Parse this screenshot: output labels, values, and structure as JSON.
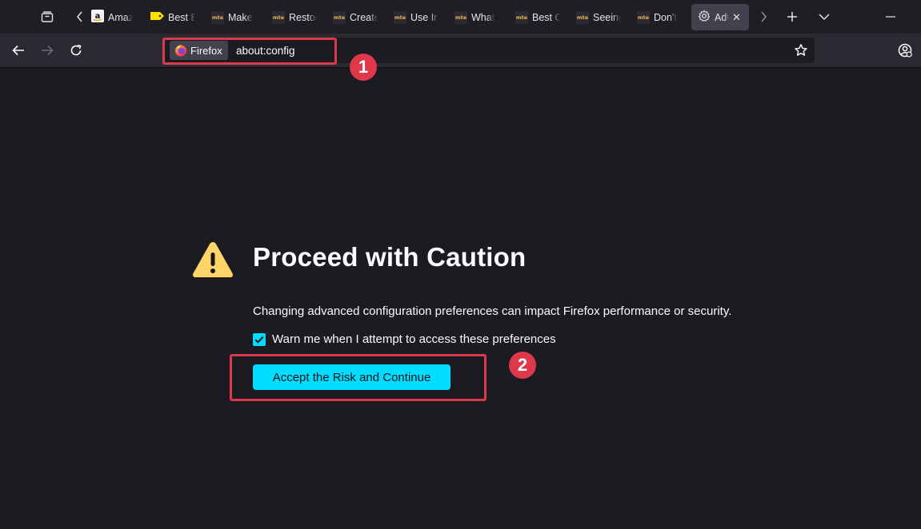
{
  "tabs": [
    {
      "title": "Amazon",
      "favicon": "amazon-icon"
    },
    {
      "title": "Best Buy",
      "favicon": "bestbuy-tag-icon"
    },
    {
      "title": "Make",
      "favicon": "mte-icon"
    },
    {
      "title": "Restore",
      "favicon": "mte-icon"
    },
    {
      "title": "Create",
      "favicon": "mte-icon"
    },
    {
      "title": "Use In",
      "favicon": "mte-icon"
    },
    {
      "title": "What",
      "favicon": "mte-icon"
    },
    {
      "title": "Best C",
      "favicon": "mte-icon"
    },
    {
      "title": "Seeing",
      "favicon": "mte-icon"
    },
    {
      "title": "Don't",
      "favicon": "mte-icon"
    },
    {
      "title": "Advanced Preferences",
      "favicon": "gear-icon",
      "active": true
    }
  ],
  "favicon_text": "mte",
  "urlbar": {
    "identity_label": "Firefox",
    "url": "about:config"
  },
  "page": {
    "heading": "Proceed with Caution",
    "description": "Changing advanced configuration preferences can impact Firefox performance or security.",
    "checkbox_label": "Warn me when I attempt to access these preferences",
    "checkbox_checked": true,
    "accept_button": "Accept the Risk and Continue"
  },
  "annotations": [
    {
      "number": "1"
    },
    {
      "number": "2"
    }
  ],
  "colors": {
    "accent": "#00ddff",
    "annotation": "#e0384b",
    "background": "#1c1b22",
    "warning": "#ffd567"
  }
}
